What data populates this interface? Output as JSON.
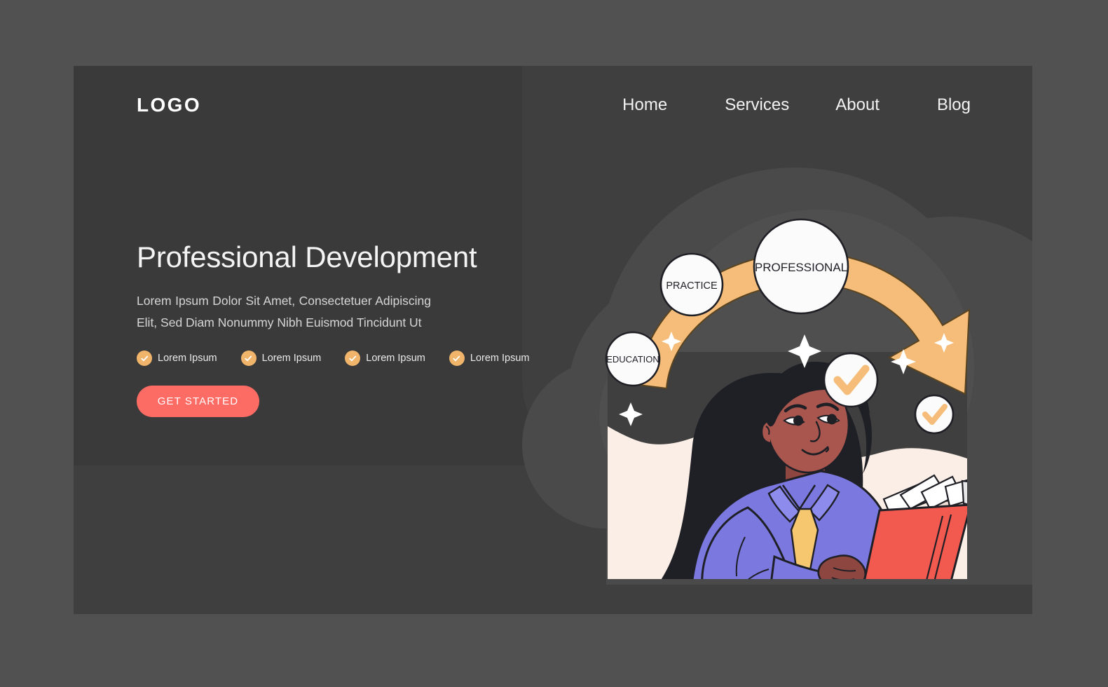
{
  "page": {
    "background_color": "#515151",
    "card_color": "#3f3f3f"
  },
  "header": {
    "logo": "LOGO",
    "nav": [
      {
        "label": "Home"
      },
      {
        "label": "Services"
      },
      {
        "label": "About"
      },
      {
        "label": "Blog"
      }
    ]
  },
  "hero": {
    "title": "Professional Development",
    "subtitle": "Lorem Ipsum Dolor Sit Amet, Consectetuer Adipiscing Elit, Sed Diam Nonummy Nibh Euismod Tincidunt Ut",
    "features": [
      {
        "label": "Lorem Ipsum",
        "icon": "check-circle-icon"
      },
      {
        "label": "Lorem Ipsum",
        "icon": "check-circle-icon"
      },
      {
        "label": "Lorem Ipsum",
        "icon": "check-circle-icon"
      },
      {
        "label": "Lorem Ipsum",
        "icon": "check-circle-icon"
      }
    ],
    "cta_label": "GET STARTED",
    "cta_color": "#fc6b64",
    "accent_color": "#f0b46a"
  },
  "illustration": {
    "bubbles": [
      {
        "label": "EDUCATION",
        "size": "small"
      },
      {
        "label": "PRACTICE",
        "size": "medium"
      },
      {
        "label": "PROFESSIONAL",
        "size": "large"
      }
    ],
    "arrow_color": "#f5bd79",
    "book_color": "#f2594f",
    "shirt_color": "#7b79e0",
    "tie_color": "#f6c76e",
    "skin_color": "#a9564e",
    "hair_color": "#1f1f26",
    "panel_color": "#fbeee6",
    "badge_count": 2,
    "sparkle_count": 5
  }
}
